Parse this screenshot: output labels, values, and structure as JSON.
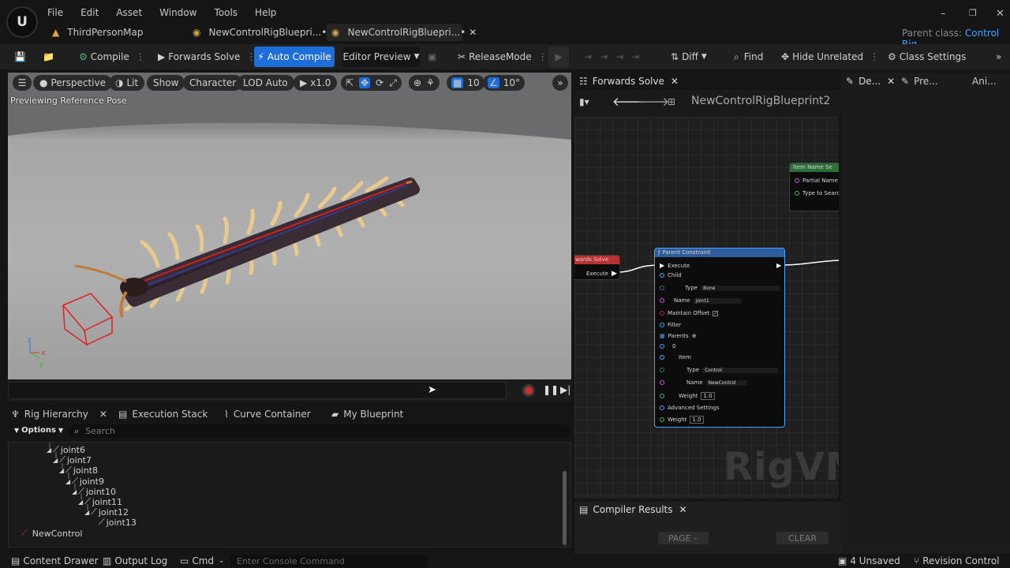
{
  "menu": [
    "File",
    "Edit",
    "Asset",
    "Window",
    "Tools",
    "Help"
  ],
  "doc_tabs": [
    "ThirdPersonMap",
    "NewControlRigBluepri...•",
    "NewControlRigBluepri...•"
  ],
  "parent_class_label": "Parent class:",
  "parent_class_value": "Control Rig",
  "toolbar": {
    "compile": "Compile",
    "forwards_solve": "Forwards Solve",
    "auto_compile": "Auto Compile",
    "editor_preview": "Editor Preview",
    "release_mode": "ReleaseMode",
    "diff": "Diff",
    "find": "Find",
    "hide_unrelated": "Hide Unrelated",
    "class_settings": "Class Settings"
  },
  "viewport": {
    "perspective": "Perspective",
    "lit": "Lit",
    "show": "Show",
    "character": "Character",
    "lod": "LOD Auto",
    "speed": "x1.0",
    "grid": "10",
    "angle": "10°",
    "preview_text": "Previewing Reference Pose"
  },
  "lower_tabs": [
    "Rig Hierarchy",
    "Execution Stack",
    "Curve Container",
    "My Blueprint"
  ],
  "options_label": "Options",
  "search_placeholder": "Search",
  "tree": [
    "joint6",
    "joint7",
    "joint8",
    "joint9",
    "joint10",
    "joint11",
    "joint12",
    "joint13",
    "NewControl"
  ],
  "graph_tab": "Forwards Solve",
  "graph_breadcrumb": "NewControlRigBlueprint2",
  "nodes": {
    "item_name_title": "Item Name Se",
    "item_name_partial": "Partial Name",
    "item_name_type": "Type to Search",
    "forwards_title": "wards Solve",
    "forwards_execute": "Execute",
    "pc_title": "Parent Constraint",
    "execute": "Execute",
    "child": "Child",
    "type": "Type",
    "bone": "Bone",
    "name": "Name",
    "joint1": "joint1",
    "maintain_offset": "Maintain Offset",
    "filter": "Filter",
    "parents": "Parents",
    "zero": "0",
    "item": "Item",
    "control": "Control",
    "new_control": "NewControl",
    "weight": "Weight",
    "weight_val": "1.0",
    "advanced": "Advanced Settings"
  },
  "watermark": "RigVM",
  "compiler_tab": "Compiler Results",
  "page_btn": "PAGE",
  "clear_btn": "CLEAR",
  "details_tabs": [
    "De...",
    "Pre...",
    "Ani..."
  ],
  "status": {
    "content_drawer": "Content Drawer",
    "output_log": "Output Log",
    "cmd": "Cmd",
    "console_placeholder": "Enter Console Command",
    "unsaved": "4 Unsaved",
    "revision": "Revision Control"
  }
}
